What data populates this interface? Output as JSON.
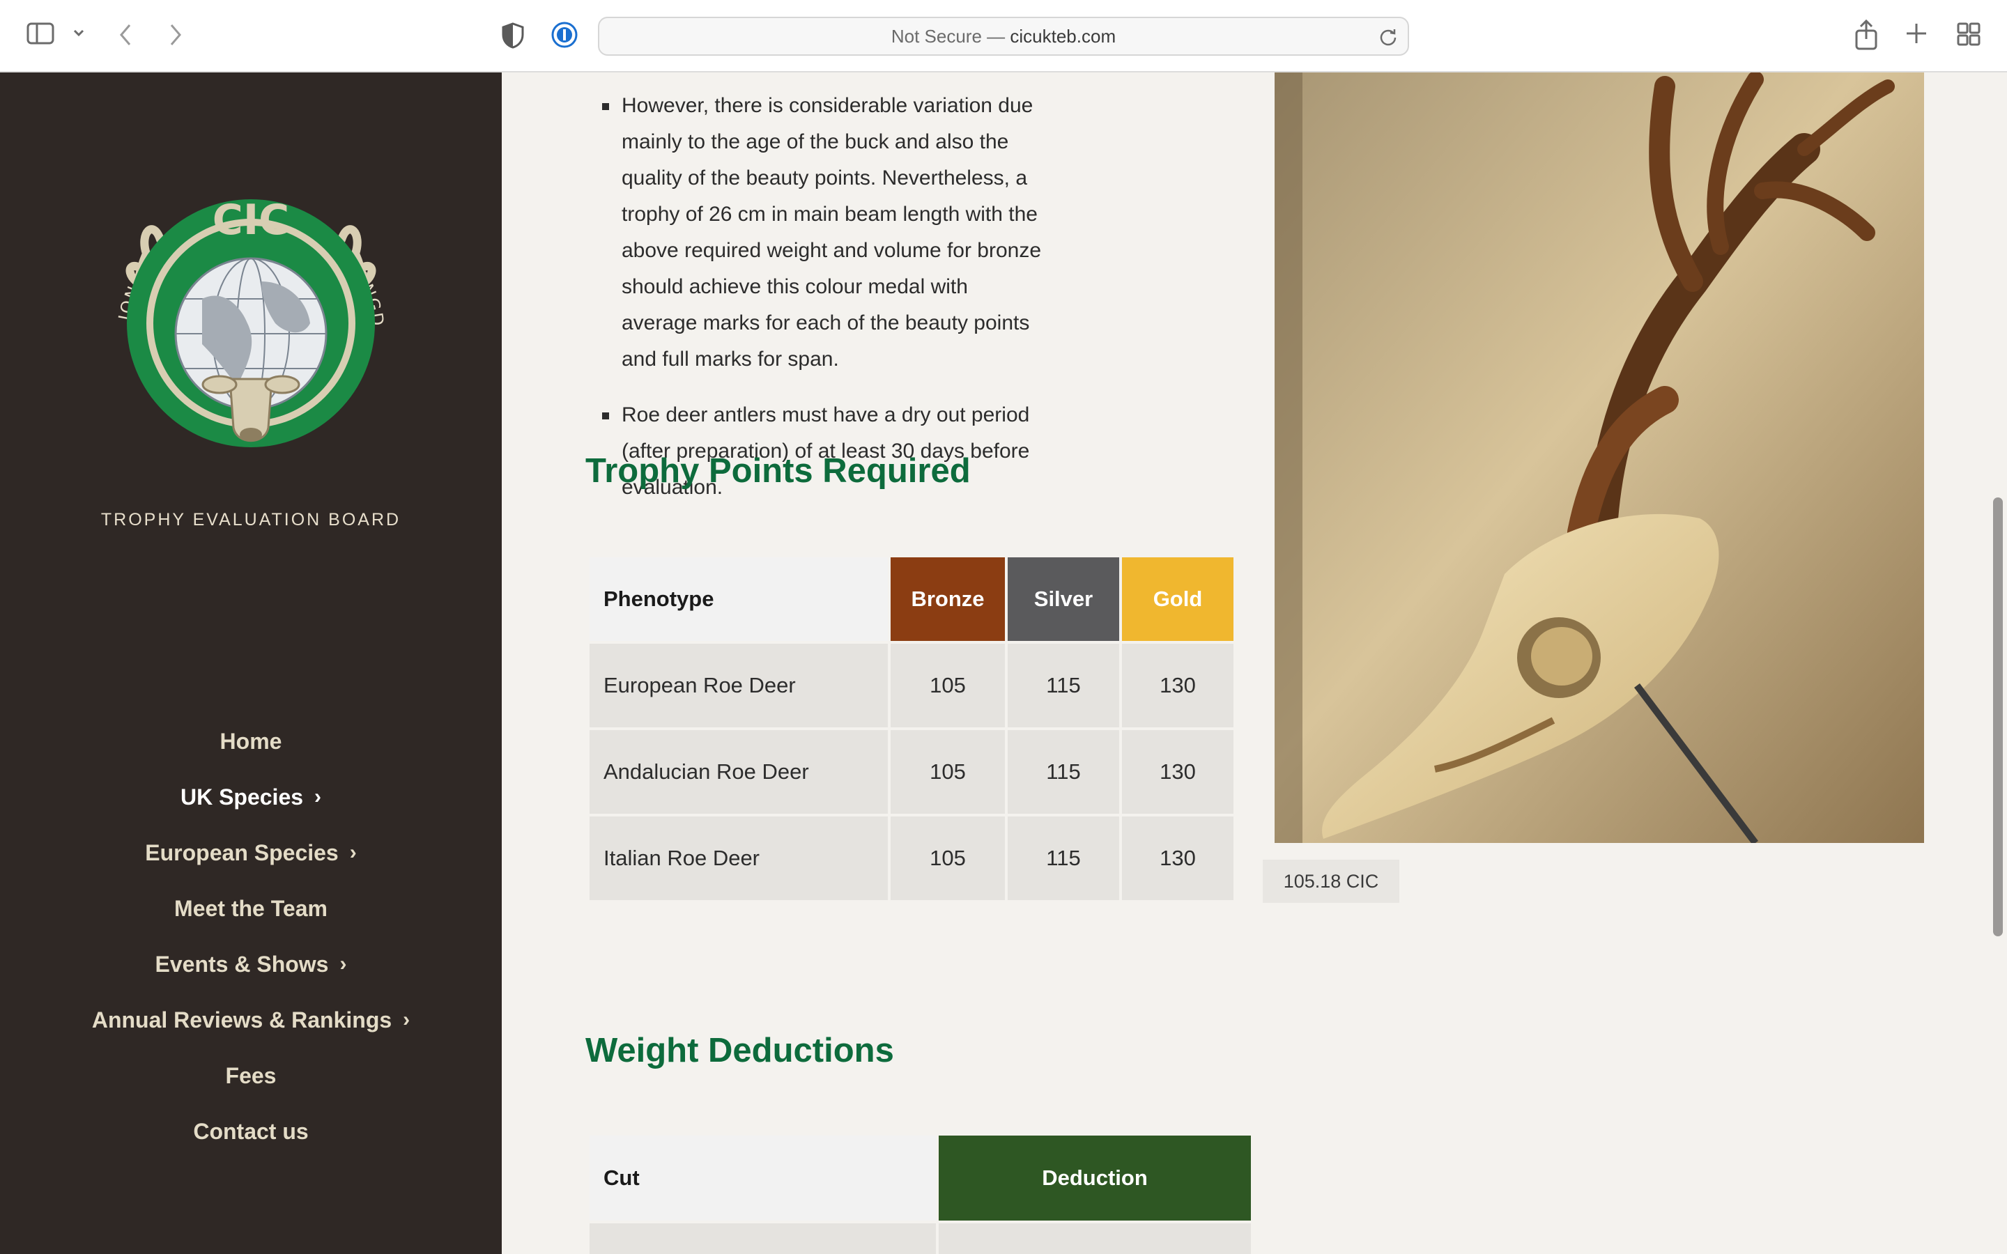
{
  "browser": {
    "url_prefix": "Not Secure —",
    "url_domain": "cicukteb.com"
  },
  "sidebar": {
    "logo": {
      "top_text": "NATIONAL DELEGATION • UNITED KINGDOM",
      "center_text": "CIC"
    },
    "board_label": "TROPHY EVALUATION BOARD",
    "nav": [
      {
        "label": "Home",
        "has_submenu": false
      },
      {
        "label": "UK Species",
        "has_submenu": true,
        "active": true
      },
      {
        "label": "European Species",
        "has_submenu": true
      },
      {
        "label": "Meet the Team",
        "has_submenu": false
      },
      {
        "label": "Events & Shows",
        "has_submenu": true
      },
      {
        "label": "Annual Reviews & Rankings",
        "has_submenu": true
      },
      {
        "label": "Fees",
        "has_submenu": false
      },
      {
        "label": "Contact us",
        "has_submenu": false
      }
    ],
    "chevron": "›"
  },
  "content": {
    "bullets": [
      "However, there is considerable variation due mainly to the age of the buck and also the quality of the beauty points. Nevertheless, a trophy of 26 cm in main beam length with the above required weight and volume for bronze should achieve this colour medal with average marks for each of the beauty points and full marks for span.",
      "Roe deer antlers must have a dry out period (after preparation) of at least 30 days before evaluation."
    ],
    "points_heading": "Trophy Points Required",
    "points_table": {
      "headers": [
        "Phenotype",
        "Bronze",
        "Silver",
        "Gold"
      ],
      "header_colors": {
        "bronze": "#8b3d12",
        "silver": "#5a5a5c",
        "gold": "#f0b72f"
      },
      "rows": [
        [
          "European Roe Deer",
          "105",
          "115",
          "130"
        ],
        [
          "Andalucian Roe Deer",
          "105",
          "115",
          "130"
        ],
        [
          "Italian Roe Deer",
          "105",
          "115",
          "130"
        ]
      ]
    },
    "deductions_heading": "Weight Deductions",
    "deductions_table": {
      "headers": [
        "Cut",
        "Deduction"
      ]
    },
    "photo_caption": "105.18 CIC"
  },
  "colors": {
    "sidebar_bg": "#2f2825",
    "heading_green": "#0d6b3c",
    "deduction_header": "#2e5723"
  }
}
